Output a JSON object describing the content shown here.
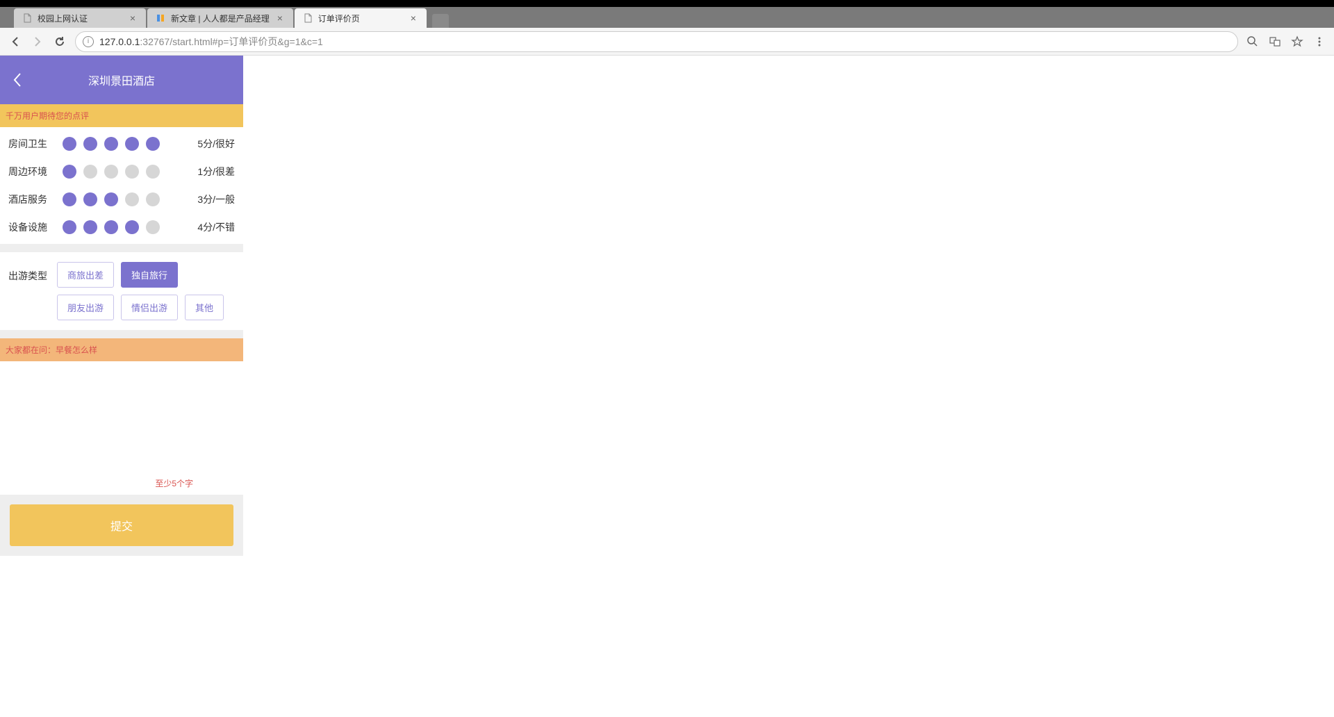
{
  "browser": {
    "tabs": [
      {
        "title": "校园上网认证",
        "favicon": "page"
      },
      {
        "title": "新文章 | 人人都是产品经理",
        "favicon": "woshipm"
      },
      {
        "title": "订单评价页",
        "favicon": "page"
      }
    ],
    "url_host": "127.0.0.1",
    "url_port": ":32767",
    "url_path": "/start.html#p=订单评价页&g=1&c=1"
  },
  "app": {
    "header_title": "深圳景田酒店",
    "banner_text": "千万用户期待您的点评",
    "ratings": [
      {
        "label": "房间卫生",
        "score": 5,
        "text": "5分/很好"
      },
      {
        "label": "周边环境",
        "score": 1,
        "text": "1分/很差"
      },
      {
        "label": "酒店服务",
        "score": 3,
        "text": "3分/一般"
      },
      {
        "label": "设备设施",
        "score": 4,
        "text": "4分/不错"
      }
    ],
    "travel_type_label": "出游类型",
    "travel_types": [
      {
        "label": "商旅出差",
        "selected": false
      },
      {
        "label": "独自旅行",
        "selected": true
      },
      {
        "label": "朋友出游",
        "selected": false
      },
      {
        "label": "情侣出游",
        "selected": false
      },
      {
        "label": "其他",
        "selected": false
      }
    ],
    "question_banner": "大家都在问：早餐怎么样",
    "char_hint": "至少5个字",
    "submit_label": "提交"
  }
}
